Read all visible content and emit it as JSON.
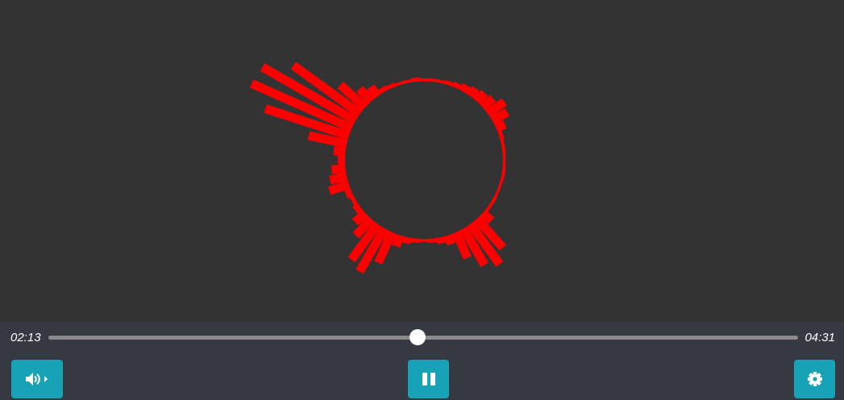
{
  "visualizer": {
    "background_color": "#333333",
    "ring_color": "#ff0000",
    "spectrum_levels": [
      0.02,
      0.03,
      0.05,
      0.1,
      0.3,
      0.45,
      0.4,
      0.2,
      0.12,
      0.05,
      0.03,
      0.05,
      0.18,
      0.15,
      0.12,
      0.06,
      0.1,
      0.35,
      0.8,
      1.0,
      0.98,
      0.75,
      0.3,
      0.15,
      0.1,
      0.04,
      0.03,
      0.02,
      0.02,
      0.03,
      0.02,
      0.02,
      0.02,
      0.03,
      0.04,
      0.06,
      0.08,
      0.1,
      0.12,
      0.18,
      0.15,
      0.08,
      0.03,
      0.02,
      0.02,
      0.01,
      0.02,
      0.02,
      0.01,
      0.01,
      0.02,
      0.02,
      0.1,
      0.35,
      0.45,
      0.38,
      0.25,
      0.08,
      0.05,
      0.03
    ]
  },
  "player": {
    "current_time": "02:13",
    "total_time": "04:31",
    "progress_fraction": 0.492,
    "accent_color": "#17a2b8",
    "controls_background": "#353a42",
    "track_color": "#8a8a8a"
  },
  "buttons": {
    "volume_icon": "volume-up-icon",
    "play_pause_icon": "pause-icon",
    "settings_icon": "gear-icon"
  }
}
